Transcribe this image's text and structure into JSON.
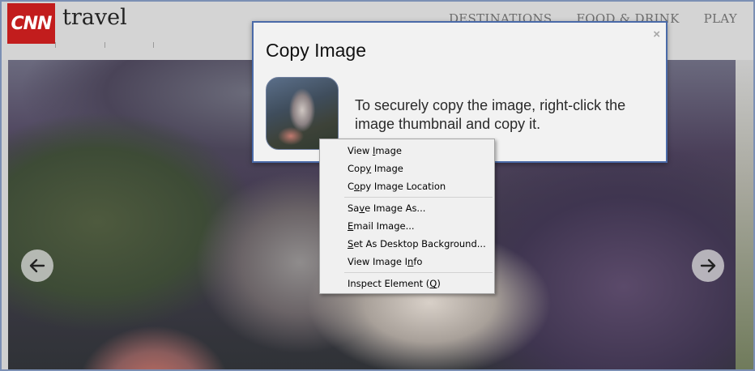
{
  "header": {
    "logo_text": "CNN",
    "brand": "travel",
    "nav": [
      "DESTINATIONS",
      "FOOD & DRINK",
      "PLAY"
    ]
  },
  "hero": {
    "prev_icon": "arrow-left-icon",
    "next_icon": "arrow-right-icon"
  },
  "dialog": {
    "title": "Copy Image",
    "close": "×",
    "message": "To securely copy the image, right-click the image thumbnail and copy it."
  },
  "context_menu": {
    "items": [
      {
        "pre": "View ",
        "key": "I",
        "post": "mage"
      },
      {
        "pre": "Cop",
        "key": "y",
        "post": " Image"
      },
      {
        "pre": "C",
        "key": "o",
        "post": "py Image Location"
      },
      {
        "pre": "Sa",
        "key": "v",
        "post": "e Image As..."
      },
      {
        "pre": "",
        "key": "E",
        "post": "mail Image..."
      },
      {
        "pre": "",
        "key": "S",
        "post": "et As Desktop Background..."
      },
      {
        "pre": "View Image I",
        "key": "n",
        "post": "fo"
      },
      {
        "pre": "Inspect Element (",
        "key": "Q",
        "post": ")"
      }
    ]
  },
  "colors": {
    "logo_red": "#c21d1d",
    "dialog_border": "#4a6aa8",
    "window_border": "#7b8fb4"
  }
}
